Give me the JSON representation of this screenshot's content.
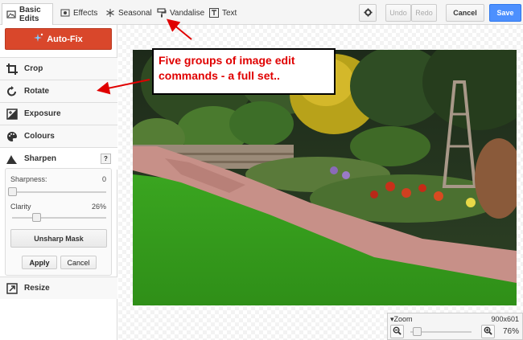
{
  "toolbar": {
    "tabs": [
      {
        "label": "Basic Edits",
        "icon": "image-icon"
      },
      {
        "label": "Effects",
        "icon": "effects-icon"
      },
      {
        "label": "Seasonal",
        "icon": "snowflake-icon"
      },
      {
        "label": "Vandalise",
        "icon": "paint-roller-icon"
      },
      {
        "label": "Text",
        "icon": "text-icon"
      }
    ],
    "undo": "Undo",
    "redo": "Redo",
    "cancel": "Cancel",
    "save": "Save"
  },
  "panel": {
    "autofix": "Auto-Fix",
    "commands": {
      "crop": "Crop",
      "rotate": "Rotate",
      "exposure": "Exposure",
      "colours": "Colours",
      "sharpen": "Sharpen",
      "resize": "Resize"
    },
    "help": "?",
    "sharpness": {
      "label": "Sharpness:",
      "value": "0",
      "level": 0
    },
    "clarity": {
      "label": "Clarity",
      "value": "26%",
      "level": 0.26
    },
    "unsharp_mask": "Unsharp Mask",
    "apply": "Apply",
    "cancel": "Cancel"
  },
  "zoom": {
    "title": "Zoom",
    "dimensions": "900x601",
    "percent": "76%",
    "level": 0.1
  },
  "annotation": {
    "text": "Five groups of image edit commands - a full set.."
  },
  "colors": {
    "accent_blue": "#4d90fe",
    "autofix_red": "#d9472b",
    "annotation_red": "#e00000"
  }
}
